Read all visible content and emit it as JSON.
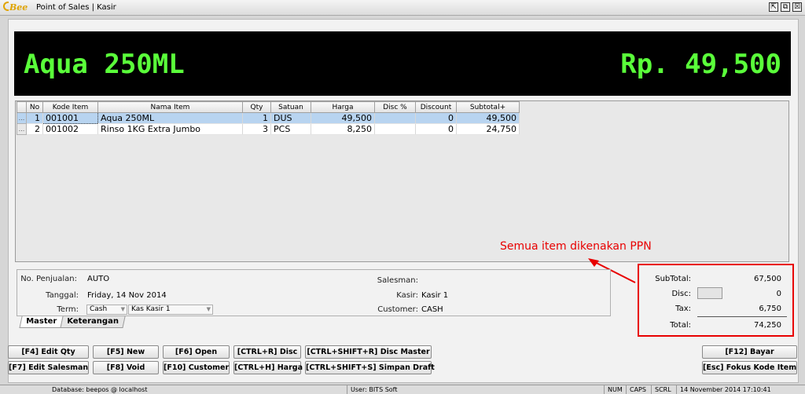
{
  "window": {
    "logo_text": "Bee",
    "title": "Point of Sales | Kasir",
    "controls": [
      "⇱",
      "⧉",
      "☒"
    ]
  },
  "display": {
    "item_name": "Aqua 250ML",
    "total": "Rp. 49,500",
    "text_color": "#5aff3a"
  },
  "table": {
    "headers": [
      "No",
      "Kode Item",
      "Nama Item",
      "Qty",
      "Satuan",
      "Harga",
      "Disc %",
      "Discount",
      "Subtotal+"
    ],
    "rows": [
      {
        "handle": "...",
        "no": "1",
        "kode": "001001",
        "nama": "Aqua 250ML",
        "qty": "1",
        "satuan": "DUS",
        "harga": "49,500",
        "disc_pct": "",
        "discount": "0",
        "subtotal": "49,500"
      },
      {
        "handle": "...",
        "no": "2",
        "kode": "001002",
        "nama": "Rinso 1KG Extra Jumbo",
        "qty": "3",
        "satuan": "PCS",
        "harga": "8,250",
        "disc_pct": "",
        "discount": "0",
        "subtotal": "24,750"
      }
    ]
  },
  "master": {
    "no_penjualan_label": "No. Penjualan:",
    "no_penjualan": "AUTO",
    "tanggal_label": "Tanggal:",
    "tanggal": "Friday, 14 Nov 2014",
    "term_label": "Term:",
    "term": "Cash",
    "kas": "Kas Kasir 1",
    "salesman_label": "Salesman:",
    "salesman": "",
    "kasir_label": "Kasir:",
    "kasir": "Kasir 1",
    "customer_label": "Customer:",
    "customer": "CASH"
  },
  "tabs": [
    "Master",
    "Keterangan"
  ],
  "annotation": "Semua item dikenakan PPN",
  "totals": {
    "subtotal_label": "SubTotal:",
    "subtotal": "67,500",
    "disc_label": "Disc:",
    "disc": "0",
    "tax_label": "Tax:",
    "tax": "6,750",
    "total_label": "Total:",
    "total": "74,250",
    "highlight_color": "#e80000"
  },
  "buttons": {
    "edit_qty": "[F4] Edit Qty",
    "new": "[F5] New",
    "open": "[F6] Open",
    "disc": "[CTRL+R] Disc",
    "disc_master": "[CTRL+SHIFT+R] Disc Master",
    "edit_salesman": "[F7] Edit Salesman",
    "void": "[F8] Void",
    "customer": "[F10] Customer",
    "harga": "[CTRL+H] Harga",
    "simpan_draft": "[CTRL+SHIFT+S] Simpan Draft",
    "bayar": "[F12] Bayar",
    "fokus": "[Esc] Fokus Kode Item"
  },
  "statusbar": {
    "database": "Database: beepos @ localhost",
    "user": "User: BITS Soft",
    "num": "NUM",
    "caps": "CAPS",
    "scrl": "SCRL",
    "datetime": "14 November 2014  17:10:41"
  }
}
